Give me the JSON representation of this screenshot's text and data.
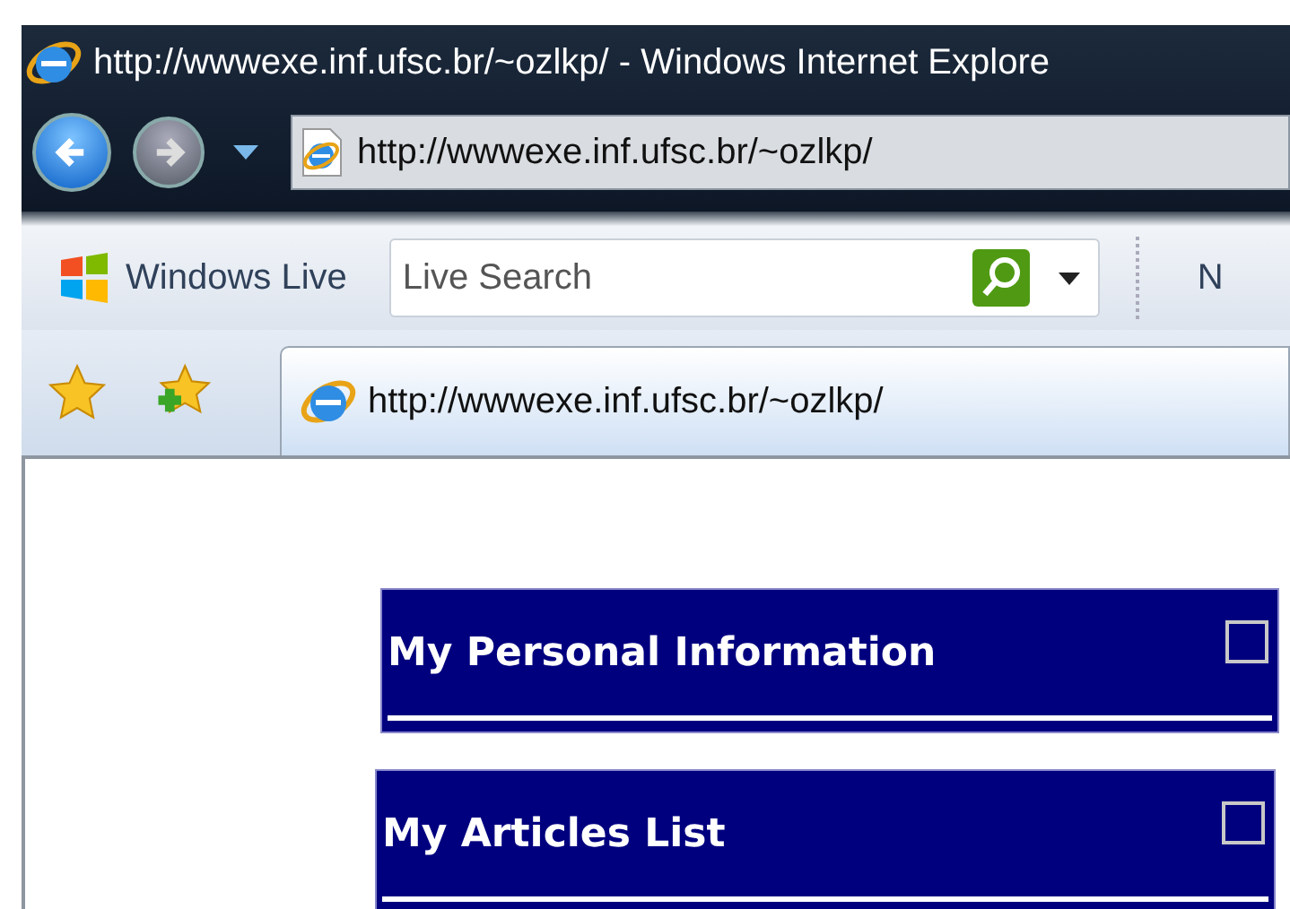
{
  "window": {
    "title": "http://wwwexe.inf.ufsc.br/~ozlkp/ - Windows Internet Explore"
  },
  "navigation": {
    "back_enabled": true,
    "forward_enabled": false
  },
  "address_bar": {
    "value": "http://wwwexe.inf.ufsc.br/~ozlkp/"
  },
  "command_bar": {
    "brand": "Windows Live",
    "search": {
      "placeholder": "Live Search"
    },
    "menu_item": "N"
  },
  "tabs": [
    {
      "label": "http://wwwexe.inf.ufsc.br/~ozlkp/",
      "selected": true
    }
  ],
  "panels": [
    {
      "title": "My Personal Information",
      "checked": false
    },
    {
      "title": "My Articles List",
      "checked": false
    }
  ]
}
